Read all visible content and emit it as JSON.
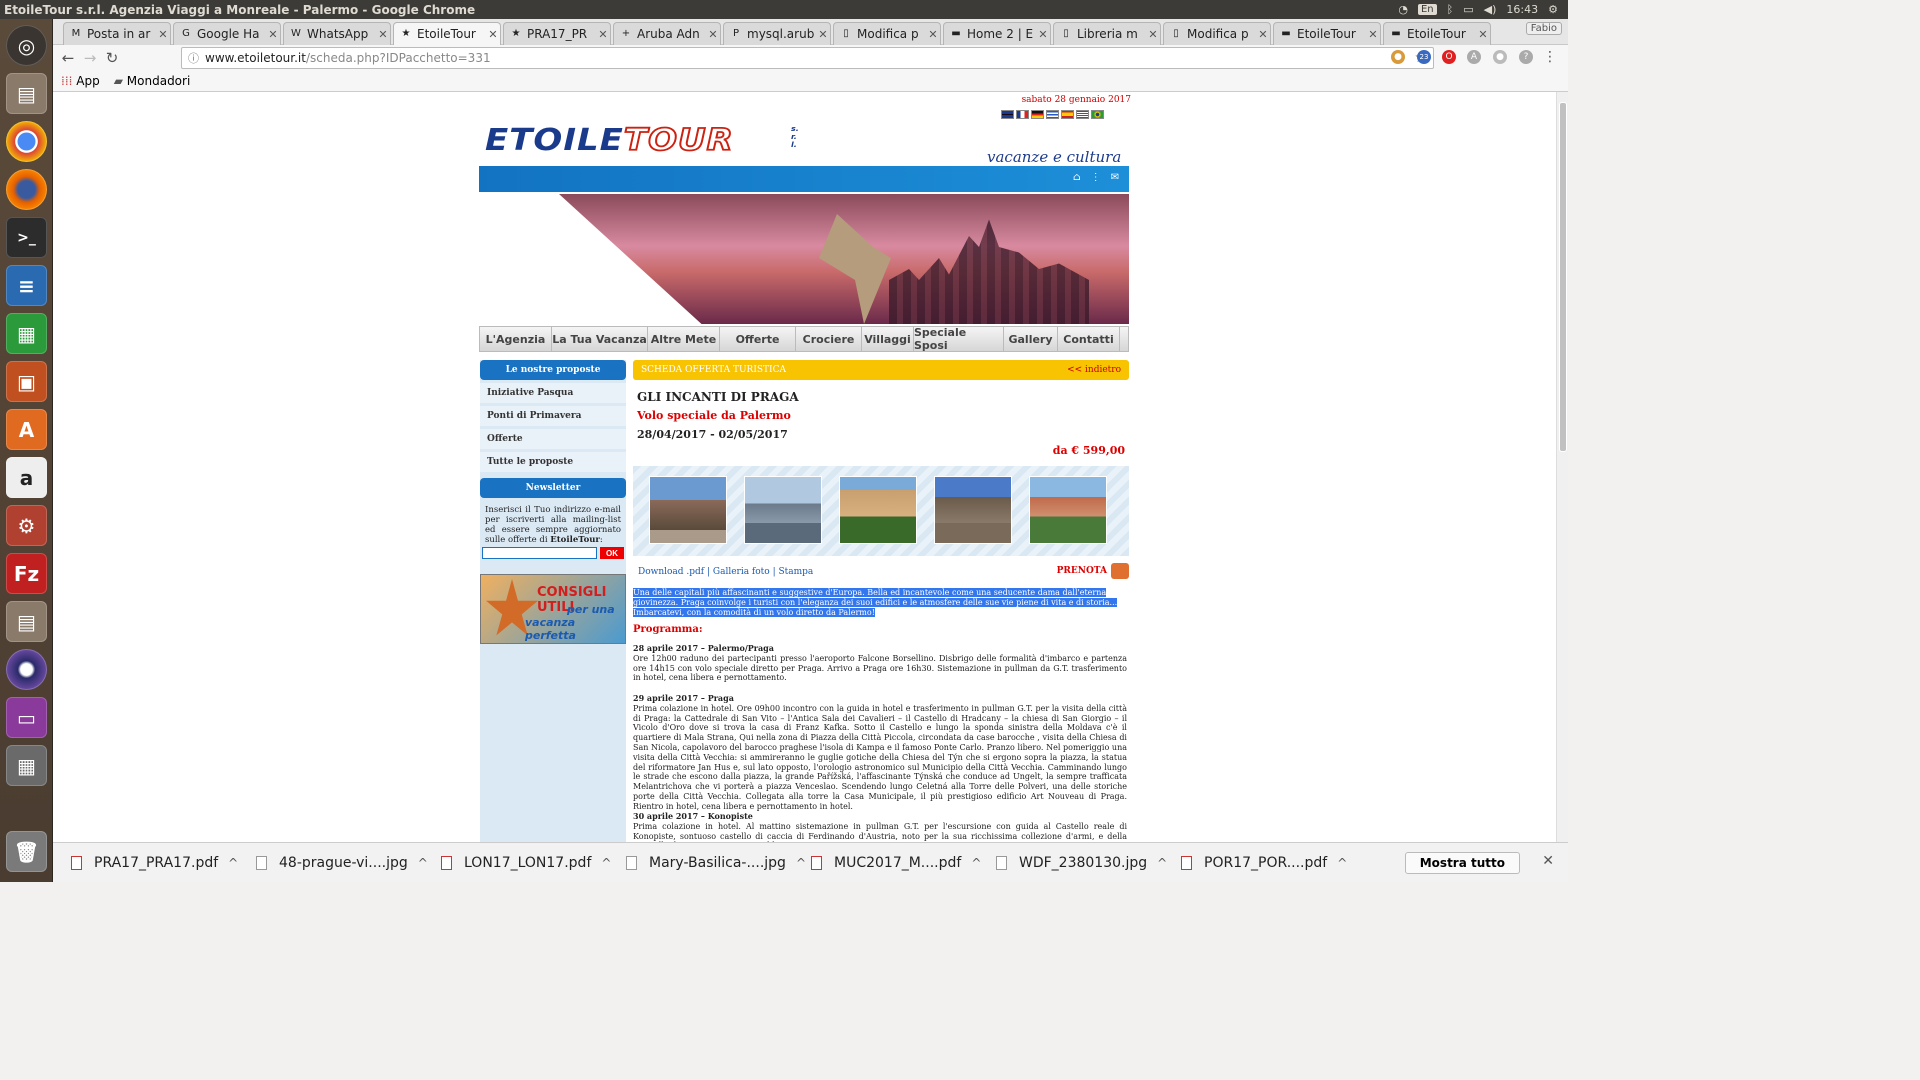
{
  "os": {
    "window_title": "EtoileTour s.r.l. Agenzia Viaggi a Monreale - Palermo - Google Chrome",
    "lang": "En",
    "clock": "16:43"
  },
  "launcher": [
    "ubuntu-dash",
    "files",
    "chrome",
    "firefox",
    "terminal",
    "writer",
    "calc",
    "impress",
    "software-center",
    "amazon",
    "system-settings",
    "filezilla",
    "files-2",
    "eclipse",
    "app-purple",
    "workspace-switcher",
    "trash"
  ],
  "tabs": [
    {
      "label": "Posta in ar",
      "icon": "M"
    },
    {
      "label": "Google Ha",
      "icon": "G"
    },
    {
      "label": "WhatsApp",
      "icon": "W"
    },
    {
      "label": "EtoileTour",
      "icon": "★",
      "active": true
    },
    {
      "label": "PRA17_PR",
      "icon": "★"
    },
    {
      "label": "Aruba Adn",
      "icon": "+"
    },
    {
      "label": "mysql.arub",
      "icon": "P"
    },
    {
      "label": "Modifica p",
      "icon": "▯"
    },
    {
      "label": "Home 2 | E",
      "icon": "▬"
    },
    {
      "label": "Libreria m",
      "icon": "▯"
    },
    {
      "label": "Modifica p",
      "icon": "▯"
    },
    {
      "label": "EtoileTour",
      "icon": "▬"
    },
    {
      "label": "EtoileTour",
      "icon": "▬"
    }
  ],
  "profile": "Fabio",
  "address": {
    "domain": "www.etoiletour.it",
    "path": "/scheda.php?IDPacchetto=331"
  },
  "bookmarks": {
    "apps": "App",
    "folder": "Mondadori"
  },
  "extension_badge": "23",
  "site": {
    "date": "sabato 28 gennaio 2017",
    "logo_a": "ETOILE",
    "logo_b": "TOUR",
    "logo_srl": "s.\nr.\nl.",
    "tagline": "vacanze e cultura",
    "menu": [
      "L'Agenzia",
      "La Tua Vacanza",
      "Altre Mete",
      "Offerte",
      "Crociere",
      "Villaggi",
      "Speciale Sposi",
      "Gallery",
      "Contatti"
    ],
    "sidebar": {
      "head": "Le nostre proposte",
      "links": [
        "Iniziative Pasqua",
        "Ponti di Primavera",
        "Offerte",
        "Tutte le proposte"
      ],
      "newsletter_head": "Newsletter",
      "newsletter_text": "Inserisci il Tuo indirizzo e-mail per iscriverti alla mailing-list ed essere sempre aggiornato sulle offerte di",
      "newsletter_brand": "EtoileTour",
      "ok": "OK",
      "banner_1": "CONSIGLI UTILI",
      "banner_2": "per una",
      "banner_3": "vacanza perfetta"
    },
    "offer": {
      "head": "SCHEDA OFFERTA TURISTICA",
      "back": "<< indietro",
      "title": "GLI INCANTI DI PRAGA",
      "subtitle": "Volo speciale da Palermo",
      "dates": "28/04/2017 - 02/05/2017",
      "price": "da  € 599,00",
      "links": "Download .pdf | Galleria foto | Stampa",
      "prenota": "PRENOTA",
      "intro": "Una delle capitali più affascinanti e suggestive d'Europa. Bella ed incantevole come una seducente dama dall'eterna giovinezza. Praga coinvolge i turisti con l'eleganza dei suoi edifici e le atmosfere delle sue vie piene di vita e di storia... Imbarcatevi, con la comodità di un volo diretto da Palermo!",
      "program_head": "Programma:",
      "days": [
        {
          "title": "28 aprile  2017 – Palermo/Praga",
          "text": "Ore 12h00 raduno dei partecipanti presso l'aeroporto Falcone Borsellino. Disbrigo delle formalità d'imbarco e partenza ore 14h15 con volo speciale diretto per Praga. Arrivo a Praga ore 16h30.  Sistemazione in pullman da G.T.  trasferimento in hotel, cena libera e pernottamento."
        },
        {
          "title": "29 aprile 2017 – Praga",
          "text": "Prima colazione in hotel. Ore 09h00 incontro con la guida in hotel e trasferimento in pullman G.T. per la visita della città di Praga: la Cattedrale di San Vito – l'Antica Sala dei Cavalieri – il Castello di Hradcany – la chiesa di San Giorgio – il Vicolo d'Oro dove si trova la casa di Franz Kafka. Sotto il Castello e lungo la sponda sinistra della Moldava c'è il quartiere di Mala Strana, Qui nella zona di Piazza della Città Piccola, circondata da case barocche , visita della Chiesa di San Nicola, capolavoro del barocco praghese l'isola di Kampa e il famoso Ponte Carlo. Pranzo libero. Nel pomeriggio una visita della Città Vecchia: si ammireranno le guglie gotiche della Chiesa del Týn che si ergono sopra la piazza, la statua del riformatore Jan Hus e, sul lato opposto, l'orologio astronomico sul Municipio della Città Vecchia. Camminando  lungo le strade che escono dalla piazza, la grande Pařížská, l'affascinante Týnská che conduce ad Ungelt, la sempre trafficata Melantrichova che vi porterà a piazza Venceslao. Scendendo lungo Celetná alla Torre delle Polveri, una delle storiche porte della Città Vecchia. Collegata alla torre la Casa Municipale, il più prestigioso edificio Art Nouveau di Praga. Rientro in hotel, cena libera e pernottamento in hotel."
        },
        {
          "title": "30 aprile 2017 – Konopiste",
          "text": "Prima colazione in hotel. Al mattino sistemazione in pullman G.T. per l'escursione con guida al Castello reale di Konopiste, sontuoso castello di caccia di Ferdinando d'Austria, noto per la sua ricchissima collezione d'armi, e della Cappella di Santa Croce. Pranzo libero."
        }
      ]
    }
  },
  "downloads": [
    {
      "name": "PRA17_PRA17.pdf",
      "type": "pdf"
    },
    {
      "name": "48-prague-vi....jpg",
      "type": "jpg"
    },
    {
      "name": "LON17_LON17.pdf",
      "type": "pdf"
    },
    {
      "name": "Mary-Basilica-....jpg",
      "type": "jpg"
    },
    {
      "name": "MUC2017_M....pdf",
      "type": "pdf"
    },
    {
      "name": "WDF_2380130.jpg",
      "type": "jpg"
    },
    {
      "name": "POR17_POR....pdf",
      "type": "pdf"
    }
  ],
  "show_all": "Mostra tutto",
  "colors": {
    "brand_blue": "#1a73c2",
    "offer_yellow": "#f8c300",
    "accent_red": "#d00"
  }
}
